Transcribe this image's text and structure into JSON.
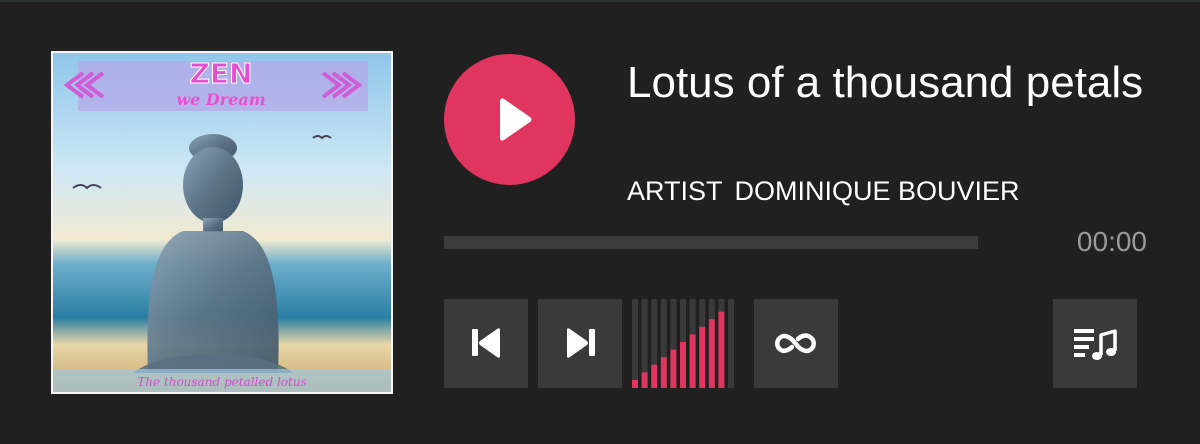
{
  "track": {
    "title": "Lotus of a thousand petals",
    "artist_label": "ARTIST",
    "artist_name": "DOMINIQUE BOUVIER",
    "time": "00:00",
    "progress": 0
  },
  "cover": {
    "title_text": "ZEN",
    "subtitle_text": "we Dream",
    "caption_text": "The thousand petalled lotus"
  },
  "volume": {
    "bars": 11,
    "active_bars": 10
  },
  "icons": {
    "play": "play-icon",
    "previous": "skip-previous-icon",
    "next": "skip-next-icon",
    "repeat": "repeat-icon",
    "playlist": "playlist-music-icon"
  },
  "colors": {
    "background": "#202020",
    "accent": "#e0355f",
    "button": "#3a3a3a",
    "track": "#3c3c3c",
    "muted_text": "#9a9a9a"
  }
}
